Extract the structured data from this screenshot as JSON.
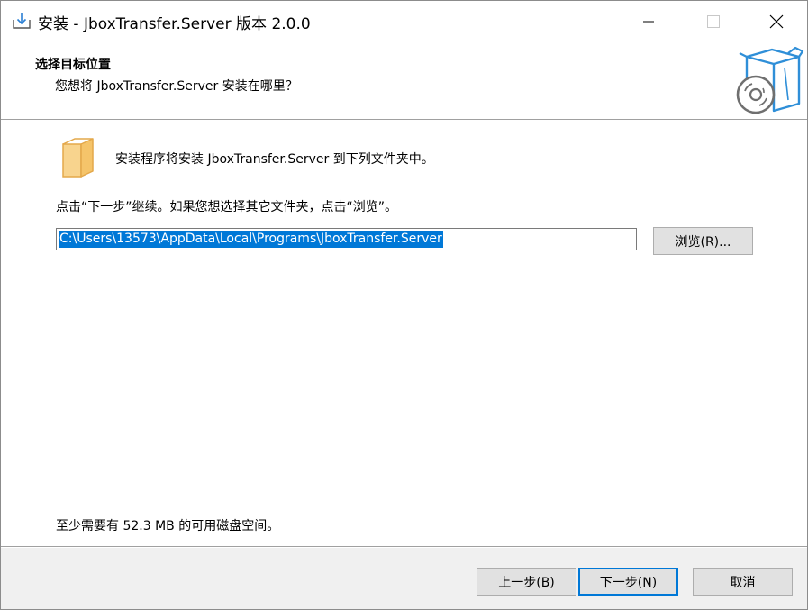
{
  "window": {
    "title": "安装 - JboxTransfer.Server 版本 2.0.0"
  },
  "header": {
    "title": "选择目标位置",
    "subtitle": "您想将 JboxTransfer.Server 安装在哪里？",
    "image_icon": "install-box-cd-icon"
  },
  "body": {
    "install_text": "安装程序将安装 JboxTransfer.Server 到下列文件夹中。",
    "instruction_text": "点击“下一步”继续。如果您想选择其它文件夹，点击“浏览”。",
    "path_value": "C:\\Users\\13573\\AppData\\Local\\Programs\\JboxTransfer.Server",
    "browse_label": "浏览(R)...",
    "space_text": "至少需要有 52.3 MB 的可用磁盘空间。"
  },
  "footer": {
    "back_label": "上一步(B)",
    "next_label": "下一步(N)",
    "cancel_label": "取消"
  },
  "colors": {
    "accent": "#0078d7",
    "button_face": "#e1e1e1",
    "footer_bg": "#f0f0f0",
    "folder": "#f5c46a"
  }
}
